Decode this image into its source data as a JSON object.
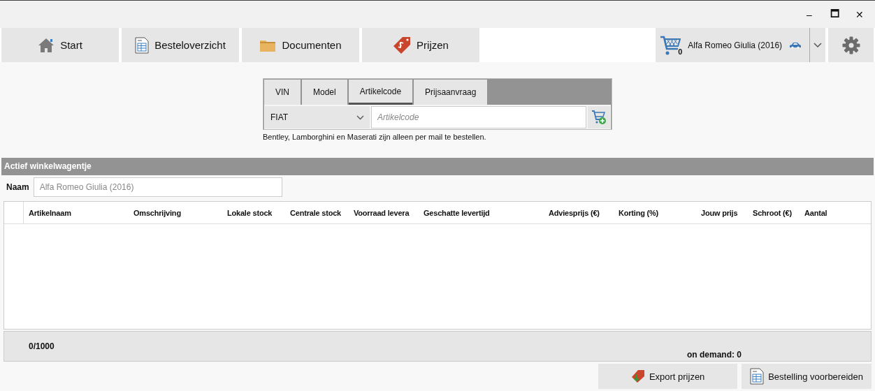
{
  "window": {
    "controls": [
      "–",
      "🗖",
      "✕"
    ]
  },
  "nav_tabs": [
    {
      "label": "Start",
      "selected": false
    },
    {
      "label": "Besteloverzicht",
      "selected": false
    },
    {
      "label": "Documenten",
      "selected": false
    },
    {
      "label": "Prijzen",
      "selected": false
    }
  ],
  "cart": {
    "count": "0",
    "name": "Alfa Romeo Giulia (2016)"
  },
  "search": {
    "tabs": [
      {
        "label": "VIN",
        "selected": false
      },
      {
        "label": "Model",
        "selected": false
      },
      {
        "label": "Artikelcode",
        "selected": true
      },
      {
        "label": "Prijsaanvraag",
        "selected": false
      }
    ],
    "brand": "FIAT",
    "placeholder": "Artikelcode",
    "note": "Bentley, Lamborghini en Maserati zijn alleen per mail te bestellen."
  },
  "active_cart": {
    "title": "Actief winkelwagentje",
    "name_label": "Naam",
    "name_placeholder": "Alfa Romeo Giulia (2016)"
  },
  "table": {
    "columns": [
      "Artikelnaam",
      "Omschrijving",
      "Lokale stock",
      "Centrale stock",
      "Voorraad levera",
      "Geschatte levertijd",
      "Adviesprijs (€)",
      "Korting (%)",
      "Jouw prijs",
      "Schroot (€)",
      "Aantal"
    ]
  },
  "footer": {
    "count": "0/1000",
    "on_demand": "on demand: 0"
  },
  "buttons": [
    {
      "label": "Export prijzen"
    },
    {
      "label": "Bestelling voorbereiden"
    }
  ]
}
